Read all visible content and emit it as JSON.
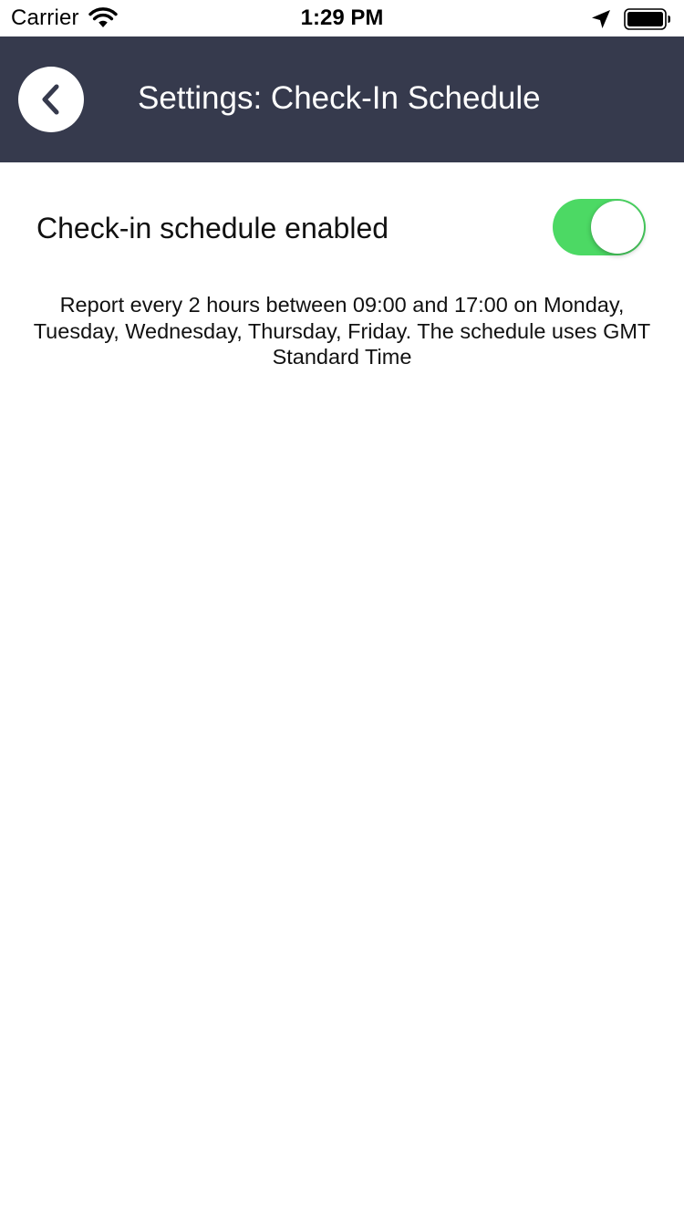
{
  "status_bar": {
    "carrier": "Carrier",
    "time": "1:29 PM",
    "icons": [
      "wifi-icon",
      "location-arrow-icon",
      "battery-icon"
    ]
  },
  "nav": {
    "back_icon": "chevron-left-icon",
    "title": "Settings: Check-In Schedule",
    "background_color": "#363a4d"
  },
  "schedule": {
    "toggle_label": "Check-in schedule enabled",
    "toggle_on": true,
    "toggle_color": "#4cd964",
    "description": "Report every 2 hours between 09:00 and 17:00 on Monday, Tuesday, Wednesday, Thursday, Friday. The schedule uses GMT Standard Time"
  }
}
